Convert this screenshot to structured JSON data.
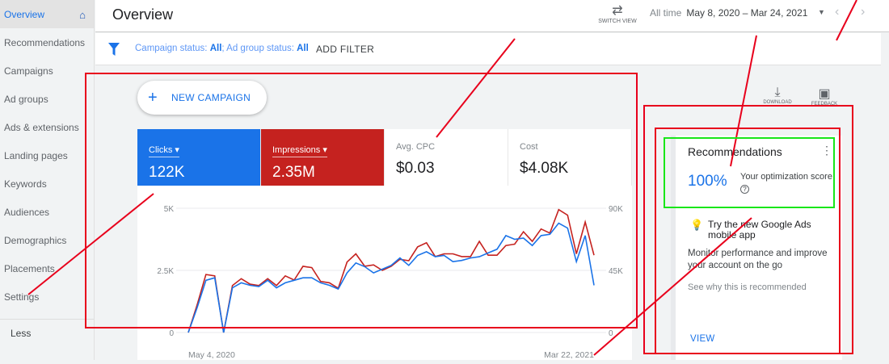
{
  "sidebar": {
    "items": [
      {
        "label": "Overview"
      },
      {
        "label": "Recommendations"
      },
      {
        "label": "Campaigns"
      },
      {
        "label": "Ad groups"
      },
      {
        "label": "Ads & extensions"
      },
      {
        "label": "Landing pages"
      },
      {
        "label": "Keywords"
      },
      {
        "label": "Audiences"
      },
      {
        "label": "Demographics"
      },
      {
        "label": "Placements"
      },
      {
        "label": "Settings"
      }
    ],
    "less": "Less"
  },
  "header": {
    "title": "Overview",
    "switch_view": "SWITCH VIEW",
    "range_label": "All time",
    "range": "May 8, 2020 – Mar 24, 2021"
  },
  "filter": {
    "campaign_label": "Campaign status:",
    "campaign_value": "All",
    "sep": ";",
    "adgroup_label": " Ad group status:",
    "adgroup_value": "All",
    "add": "ADD FILTER"
  },
  "new_campaign": "NEW CAMPAIGN",
  "tools": {
    "download": "DOWNLOAD",
    "feedback": "FEEDBACK"
  },
  "metrics": [
    {
      "label": "Clicks ▾",
      "value": "122K"
    },
    {
      "label": "Impressions ▾",
      "value": "2.35M"
    },
    {
      "label": "Avg. CPC",
      "value": "$0.03"
    },
    {
      "label": "Cost",
      "value": "$4.08K"
    }
  ],
  "chart_data": {
    "type": "line",
    "x_start": "May 4, 2020",
    "x_end": "Mar 22, 2021",
    "left_ticks": [
      "0",
      "2.5K",
      "5K"
    ],
    "right_ticks": [
      "0",
      "45K",
      "90K"
    ],
    "ylim_left": [
      0,
      5000
    ],
    "ylim_right": [
      0,
      90000
    ],
    "series": [
      {
        "name": "Clicks",
        "color": "#1a73e8",
        "axis": "left",
        "values": [
          0,
          1000,
          2100,
          2200,
          0,
          1800,
          2000,
          1900,
          1850,
          2100,
          1800,
          2000,
          2100,
          2200,
          2200,
          2000,
          1900,
          1750,
          2400,
          2800,
          2650,
          2400,
          2550,
          2700,
          3000,
          2700,
          3100,
          3250,
          3050,
          3100,
          2850,
          2900,
          3000,
          3050,
          3200,
          3350,
          3900,
          3750,
          3800,
          3500,
          3900,
          3950,
          4400,
          4200,
          2850,
          3900,
          1900
        ]
      },
      {
        "name": "Impressions",
        "color": "#c5221f",
        "axis": "right",
        "values": [
          0,
          20000,
          42000,
          41000,
          0,
          34000,
          39000,
          35000,
          34000,
          39000,
          34000,
          41000,
          38000,
          48000,
          47000,
          37000,
          36000,
          32000,
          51000,
          57000,
          48000,
          49000,
          45000,
          48000,
          53000,
          52000,
          62000,
          65000,
          55000,
          57000,
          57000,
          55000,
          55000,
          66000,
          56000,
          56000,
          63000,
          64000,
          73000,
          66000,
          75000,
          72000,
          89000,
          85000,
          57000,
          80000,
          56000
        ]
      }
    ]
  },
  "recommendations": {
    "title": "Recommendations",
    "score": "100%",
    "score_label": "Your optimization score",
    "tip": "Try the new Google Ads mobile app",
    "desc": "Monitor performance and improve your account on the go",
    "see": "See why this is recommended",
    "view": "VIEW"
  }
}
